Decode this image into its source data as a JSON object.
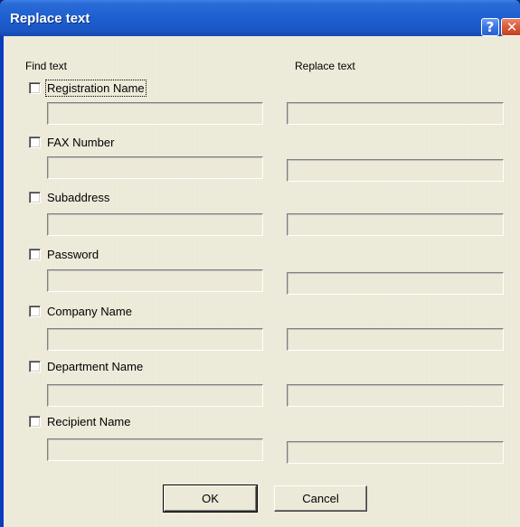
{
  "window": {
    "title": "Replace text",
    "help_label": "?",
    "close_label": "✕"
  },
  "headers": {
    "find": "Find text",
    "replace": "Replace text"
  },
  "rows": [
    {
      "label": "Registration Name",
      "checked": false,
      "find_value": "",
      "replace_value": ""
    },
    {
      "label": "FAX Number",
      "checked": false,
      "find_value": "",
      "replace_value": ""
    },
    {
      "label": "Subaddress",
      "checked": false,
      "find_value": "",
      "replace_value": ""
    },
    {
      "label": "Password",
      "checked": false,
      "find_value": "",
      "replace_value": ""
    },
    {
      "label": "Company Name",
      "checked": false,
      "find_value": "",
      "replace_value": ""
    },
    {
      "label": "Department Name",
      "checked": false,
      "find_value": "",
      "replace_value": ""
    },
    {
      "label": "Recipient Name",
      "checked": false,
      "find_value": "",
      "replace_value": ""
    }
  ],
  "buttons": {
    "ok": "OK",
    "cancel": "Cancel"
  }
}
